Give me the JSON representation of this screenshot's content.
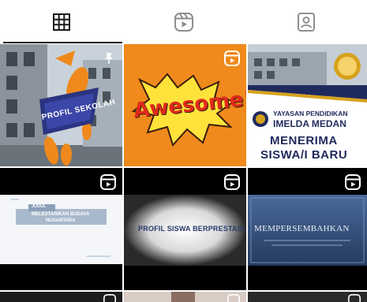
{
  "tabs": [
    {
      "name": "grid-icon",
      "active": true
    },
    {
      "name": "reels-icon",
      "active": false
    },
    {
      "name": "tagged-icon",
      "active": false
    }
  ],
  "posts": {
    "p1": {
      "title": "PROFIL SEKOLAH"
    },
    "p2": {
      "title": "Awesome!"
    },
    "p3": {
      "line1": "YAYASAN PENDIDIKAN",
      "line2": "IMELDA MEDAN",
      "line3": "MENERIMA",
      "line4": "SISWA/I BARU"
    },
    "p4": {
      "tag": "JUDUL",
      "line1": "MELESTARIKAN BUDAYA",
      "line2": "NUSANTARA"
    },
    "p5": {
      "title": "PROFIL SISWA BERPRESTASI"
    },
    "p6": {
      "title": "MEMPERSEMBAHKAN"
    }
  },
  "colors": {
    "orange": "#f0891c",
    "navy": "#1f2a5c",
    "gold": "#d6a21c"
  }
}
